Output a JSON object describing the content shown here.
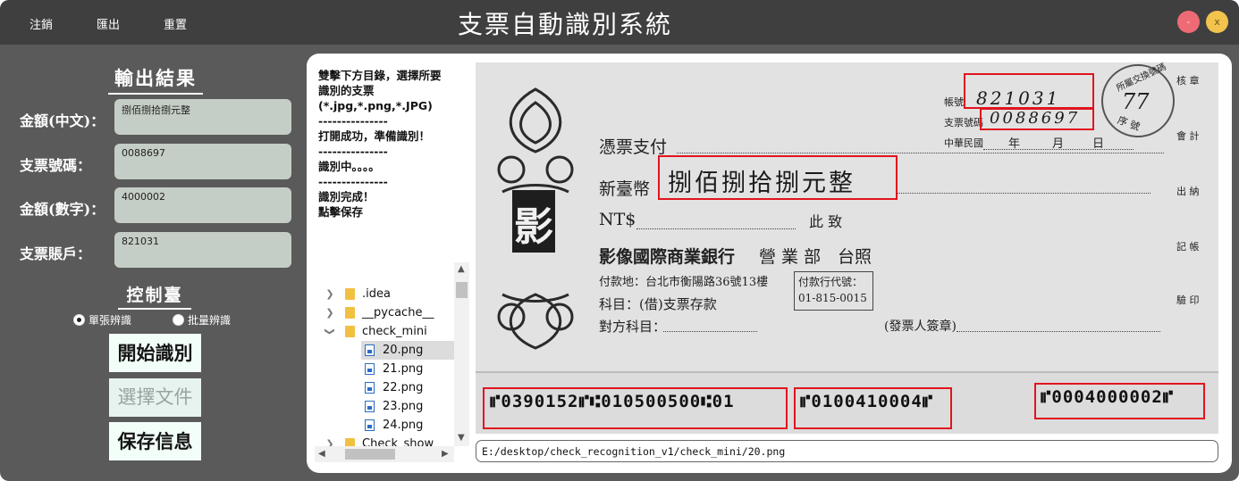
{
  "menu": {
    "logout": "注銷",
    "export": "匯出",
    "reset": "重置"
  },
  "title": "支票自動識別系統",
  "window": {
    "minimize": "-",
    "close": "x"
  },
  "output": {
    "title": "輸出結果",
    "fields": [
      {
        "label": "金額(中文)：",
        "value": "捌佰捌拾捌元整"
      },
      {
        "label": "支票號碼：",
        "value": "0088697"
      },
      {
        "label": "金額(數字)：",
        "value": "4000002"
      },
      {
        "label": "支票賬戶：",
        "value": "821031"
      }
    ]
  },
  "control": {
    "title": "控制臺",
    "radio_single": "單張辨識",
    "radio_batch": "批量辨識",
    "selected_mode": "單張辨識",
    "start_btn": "開始識別",
    "select_btn": "選擇文件",
    "save_btn": "保存信息"
  },
  "log": [
    "雙擊下方目錄，選擇所要",
    "識別的支票",
    "(*.jpg,*.png,*.JPG)",
    "---------------",
    "打開成功，準備識別！",
    "---------------",
    "識別中。。。。",
    "---------------",
    "識別完成！",
    "點擊保存"
  ],
  "tree": {
    "items": [
      {
        "name": ".idea",
        "type": "folder",
        "level": 0,
        "expanded": false
      },
      {
        "name": "__pycache__",
        "type": "folder",
        "level": 0,
        "expanded": false
      },
      {
        "name": "check_mini",
        "type": "folder",
        "level": 0,
        "expanded": true
      },
      {
        "name": "20.png",
        "type": "file",
        "level": 1,
        "selected": true
      },
      {
        "name": "21.png",
        "type": "file",
        "level": 1
      },
      {
        "name": "22.png",
        "type": "file",
        "level": 1
      },
      {
        "name": "23.png",
        "type": "file",
        "level": 1
      },
      {
        "name": "24.png",
        "type": "file",
        "level": 1
      },
      {
        "name": "Check_show",
        "type": "folder",
        "level": 0,
        "expanded": false
      }
    ]
  },
  "cheque": {
    "account_label": "帳號",
    "account_handwritten": "821031",
    "number_label": "支票號碼",
    "number_handwritten": "0088697",
    "date_label": "中華民國",
    "year": "年",
    "month": "月",
    "day": "日",
    "pay_to": "憑票支付",
    "currency_cn": "新臺幣",
    "amount_cn_handwritten": "捌佰捌拾捌元整",
    "currency_num": "NT$",
    "ci_zhi": "此 致",
    "bank_name": "影像國際商業銀行",
    "branch": "營 業 部",
    "bank_stamp": "台照",
    "pay_place": "付款地：台北市衡陽路36號13樓",
    "agent_code_label": "付款行代號：",
    "agent_code": "01-815-0015",
    "subject": "科目：(借)支票存款",
    "counter_subject": "對方科目：",
    "signature": "(發票人簽章)",
    "seal_char": "影",
    "side_labels": [
      "核 章",
      "會 計",
      "出 納",
      "記 帳",
      "驗 印"
    ],
    "stamp_top": "所屬交換號碼",
    "stamp_number": "77",
    "stamp_bottom": "序 號",
    "micr_left": "⑈0390152⑈⑆010500500⑆01",
    "micr_mid": "⑈0100410004⑈",
    "micr_right": "⑈0004000002⑈"
  },
  "path": "E:/desktop/check_recognition_v1/check_mini/20.png"
}
